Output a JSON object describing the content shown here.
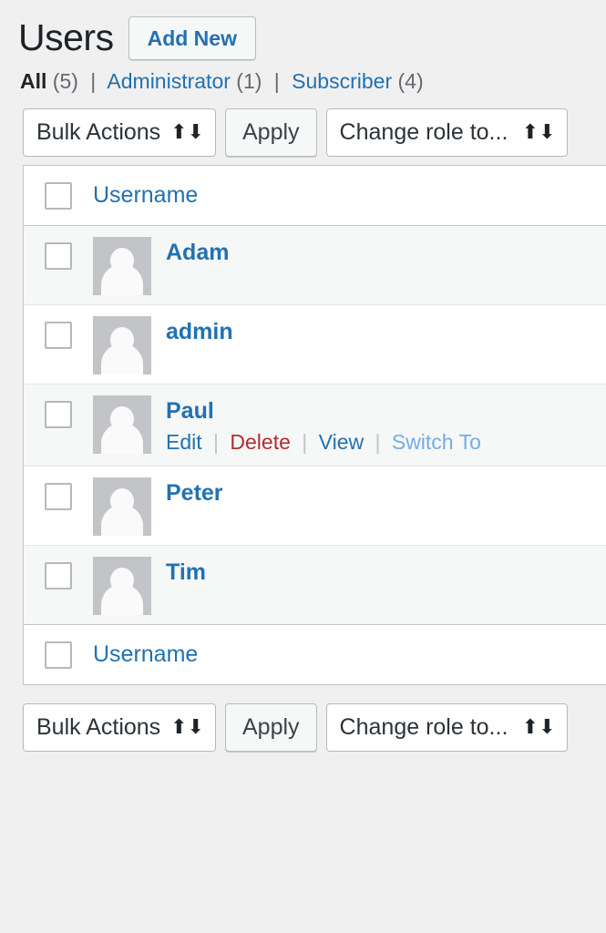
{
  "header": {
    "title": "Users",
    "add_new_label": "Add New"
  },
  "filters": {
    "separator": "|",
    "items": [
      {
        "label": "All",
        "count": "(5)",
        "current": true
      },
      {
        "label": "Administrator",
        "count": "(1)",
        "current": false
      },
      {
        "label": "Subscriber",
        "count": "(4)",
        "current": false
      }
    ]
  },
  "toolbar_top": {
    "bulk_actions_value": "Bulk Actions",
    "apply_label": "Apply",
    "change_role_value": "Change role to...",
    "select_arrow_icon": "↕"
  },
  "toolbar_bottom": {
    "bulk_actions_value": "Bulk Actions",
    "apply_label": "Apply",
    "change_role_value": "Change role to...",
    "select_arrow_icon": "↕"
  },
  "table": {
    "column_header": "Username",
    "column_footer": "Username",
    "rows": [
      {
        "username": "Adam"
      },
      {
        "username": "admin"
      },
      {
        "username": "Paul",
        "actions": [
          {
            "label": "Edit",
            "kind": "edit"
          },
          {
            "label": "Delete",
            "kind": "delete"
          },
          {
            "label": "View",
            "kind": "view"
          },
          {
            "label": "Switch To",
            "kind": "switch"
          }
        ],
        "action_divider": "|"
      },
      {
        "username": "Peter"
      },
      {
        "username": "Tim"
      }
    ]
  },
  "colors": {
    "link_blue": "#2271b1",
    "delete_red": "#b32d2e",
    "switch_blue": "#72aee6",
    "page_bg": "#f0f0f1",
    "stripe_bg": "#f6f7f7",
    "avatar_bg": "#c3c4c7",
    "heading": "#1d2327"
  }
}
